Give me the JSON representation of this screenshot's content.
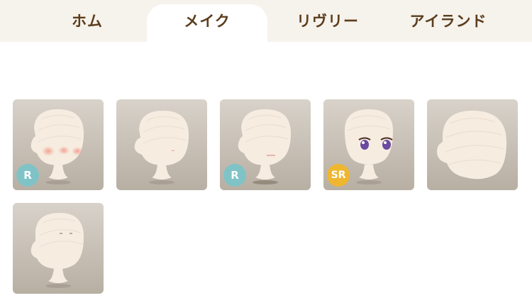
{
  "tabs": [
    {
      "label": "ホム",
      "active": false
    },
    {
      "label": "メイク",
      "active": true
    },
    {
      "label": "リヴリー",
      "active": false
    },
    {
      "label": "アイランド",
      "active": false
    }
  ],
  "items": [
    {
      "name": "head-blush",
      "rarity": "R"
    },
    {
      "name": "head-plain-small-mark",
      "rarity": ""
    },
    {
      "name": "head-mouth-line",
      "rarity": "R"
    },
    {
      "name": "head-purple-eyes",
      "rarity": "SR"
    },
    {
      "name": "head-large-round",
      "rarity": ""
    },
    {
      "name": "head-closed-eyes",
      "rarity": ""
    }
  ],
  "colors": {
    "tab_text": "#5b3d1c",
    "tab_bar_bg": "#f6f2ec",
    "active_tab_bg": "#ffffff",
    "tile_bg_top": "#d6d0c8",
    "tile_bg_bottom": "#b9b0a4",
    "badge_r": "#7fc3c7",
    "badge_sr": "#efb630",
    "head_fill": "#f5ebdf",
    "blush": "#f3a79a",
    "eye_purple": "#6c4a9e"
  }
}
